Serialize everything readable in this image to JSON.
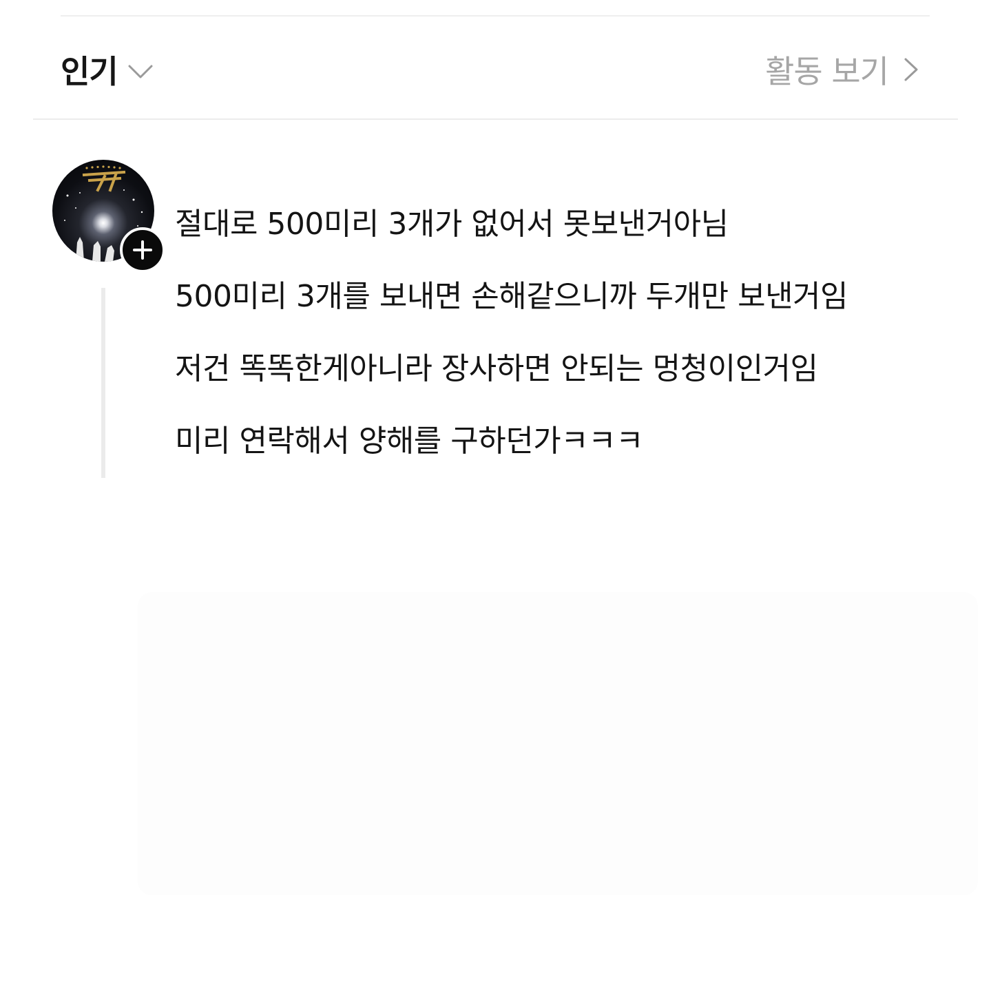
{
  "header": {
    "sort_label": "인기",
    "activity_label": "활동 보기"
  },
  "comment": {
    "lines": [
      "절대로 500미리 3개가 없어서 못보낸거아님",
      "500미리 3개를 보내면 손해같으니까 두개만 보낸거임",
      "저건 똑똑한게아니라 장사하면 안되는 멍청이인거임",
      "미리 연락해서 양해를 구하던가ㅋㅋㅋ"
    ]
  },
  "icons": {
    "sort": "chevron-down-icon",
    "activity": "chevron-right-icon",
    "follow": "plus-icon"
  },
  "colors": {
    "text": "#141414",
    "muted": "#a6a6a6",
    "follow_button": "#0a0a0a",
    "divider": "#ececec"
  }
}
